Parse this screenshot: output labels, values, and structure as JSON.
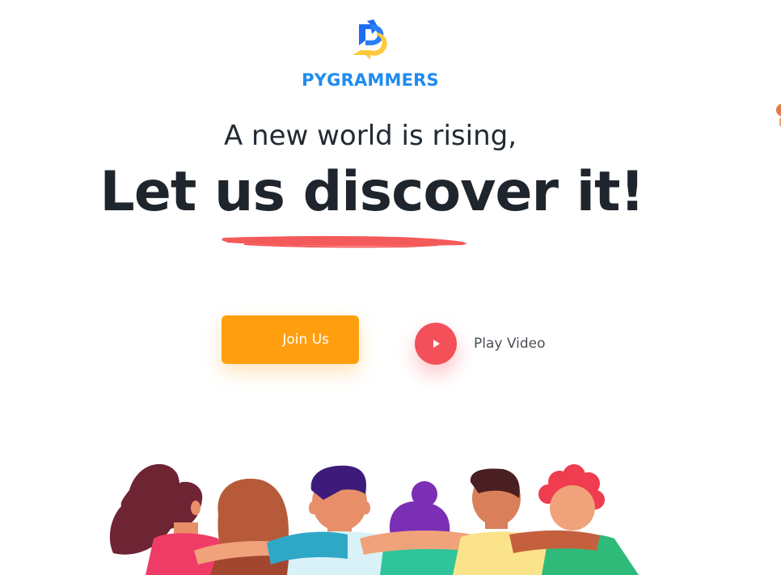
{
  "brand": {
    "name": "PYGRAMMERS",
    "logo_icon": "pygrammers-logo-icon",
    "color": "#1f8bf0"
  },
  "hero": {
    "subtitle": "A new world is rising,",
    "headline": "Let us discover it!",
    "underline_color": "#f55a5a"
  },
  "actions": {
    "join_label": "Join Us",
    "join_color": "#ff9f10",
    "play_label": "Play Video",
    "play_icon": "play-icon",
    "play_color": "#f3505a"
  },
  "illustration": {
    "name": "group-of-friends-illustration"
  }
}
